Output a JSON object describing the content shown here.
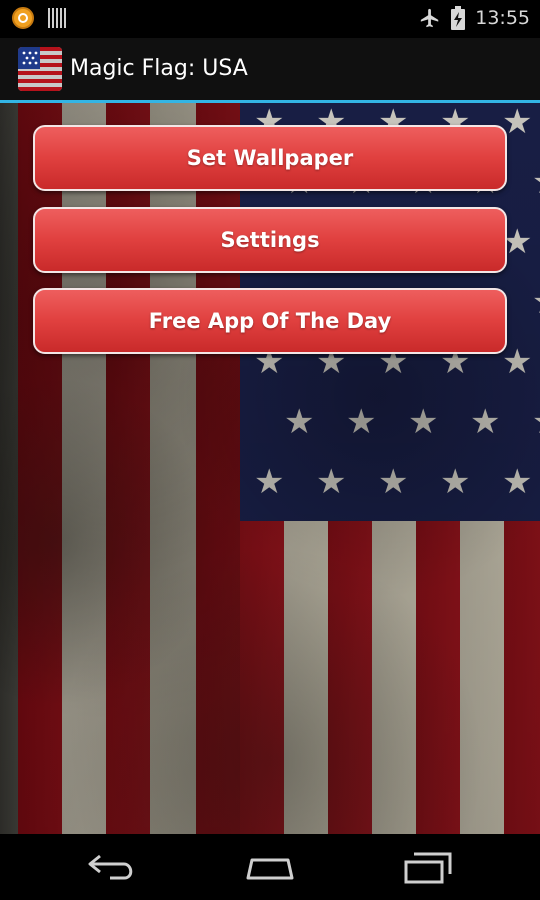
{
  "status_bar": {
    "time": "13:55",
    "icons": [
      "notification-circle-icon",
      "barcode-icon",
      "airplane-mode-icon",
      "battery-charging-icon"
    ]
  },
  "action_bar": {
    "title": "Magic Flag: USA",
    "icon": "usa-flag-app-icon"
  },
  "menu": {
    "set_wallpaper": "Set Wallpaper",
    "settings": "Settings",
    "free_app": "Free App Of The Day"
  },
  "nav_bar": {
    "icons": [
      "back-icon",
      "home-icon",
      "recent-apps-icon"
    ]
  },
  "colors": {
    "accent": "#33b5e5",
    "button_red": "#e0403f",
    "flag_blue": "#1c2350",
    "flag_red": "#8e1018",
    "flag_white": "#c9c3b2"
  }
}
